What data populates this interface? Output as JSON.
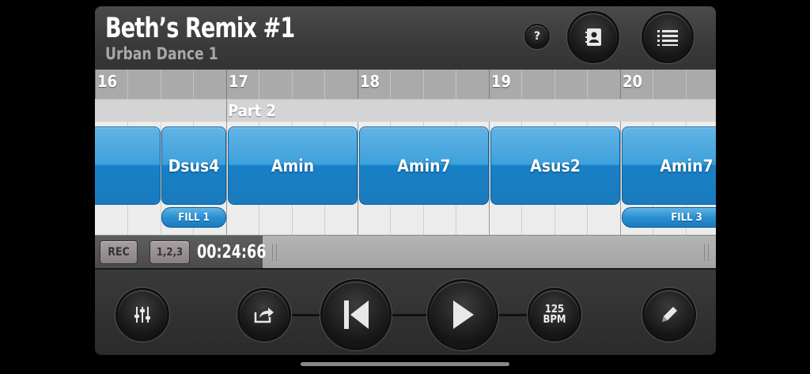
{
  "header": {
    "title": "Beth’s Remix #1",
    "subtitle": "Urban Dance 1",
    "help_label": "?",
    "contacts_icon": "contacts-book-icon",
    "list_icon": "list-icon"
  },
  "timeline": {
    "bars": [
      "16",
      "17",
      "18",
      "19",
      "20"
    ],
    "part_label": "Part 2",
    "chords": [
      "Dsus4",
      "Amin",
      "Amin7",
      "Asus2",
      "Amin7"
    ],
    "fills": [
      "FILL 1",
      "FILL 3"
    ]
  },
  "status": {
    "rec_label": "REC",
    "count_in_label": "1,2,3",
    "time": "00:24:66"
  },
  "transport": {
    "bpm_value": "125",
    "bpm_unit": "BPM",
    "mixer_icon": "mixer-sliders-icon",
    "share_icon": "share-icon",
    "prev_icon": "skip-back-icon",
    "play_icon": "play-icon",
    "edit_icon": "pencil-icon"
  },
  "colors": {
    "chord_blue": "#2a8fd1",
    "background": "#2a2a2a"
  }
}
